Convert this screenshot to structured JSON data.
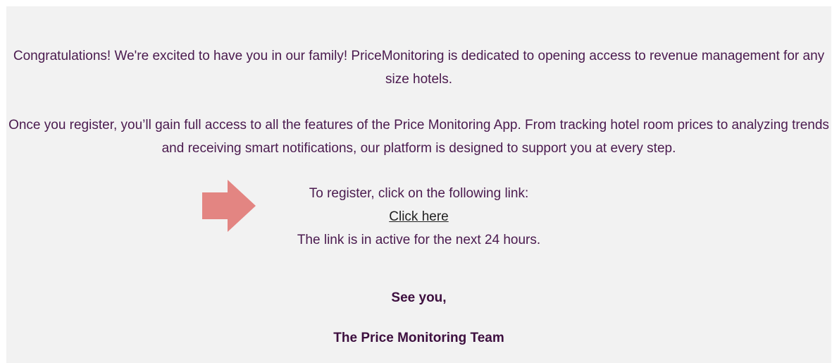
{
  "email": {
    "intro": "Congratulations! We're excited to have you in our family! PriceMonitoring is dedicated to opening access to revenue management for any size hotels.",
    "body": "Once you register, you’ll gain full access to all the features of the Price Monitoring App. From tracking hotel room prices to analyzing trends and receiving smart notifications, our platform is designed to support you at every step.",
    "register_prompt": "To register, click on the following link:",
    "register_link": "Click here",
    "link_notice": "The link is in active for the next 24 hours.",
    "signoff_greeting": "See you,",
    "signoff_team": "The Price Monitoring Team"
  },
  "icons": {
    "pointer_arrow": "arrow-right-icon"
  },
  "colors": {
    "background": "#f2f2f2",
    "text": "#4a1a4e",
    "signoff": "#3d0f3f",
    "arrow": "#e38582"
  }
}
